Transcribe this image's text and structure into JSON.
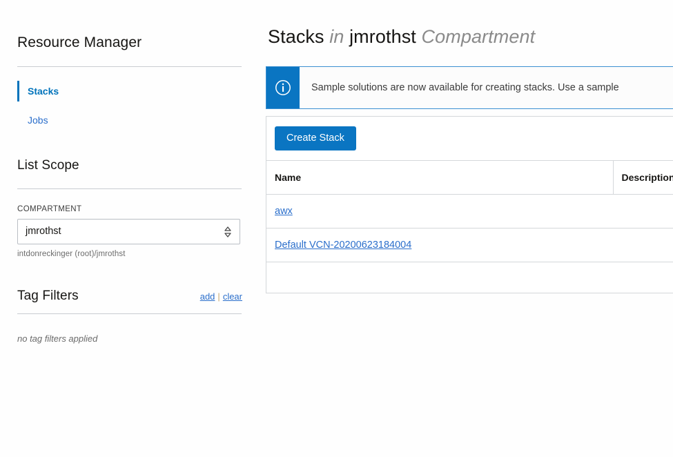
{
  "sidebar": {
    "title": "Resource Manager",
    "nav": [
      {
        "label": "Stacks",
        "active": true
      },
      {
        "label": "Jobs",
        "active": false
      }
    ],
    "list_scope": {
      "title": "List Scope",
      "compartment_label": "COMPARTMENT",
      "compartment_value": "jmrothst",
      "compartment_path": "intdonreckinger (root)/jmrothst",
      "stepper_icon": "chevron-up-down-icon"
    },
    "tag_filters": {
      "title": "Tag Filters",
      "add_label": "add",
      "separator": "|",
      "clear_label": "clear",
      "empty_message": "no tag filters applied"
    }
  },
  "main": {
    "heading": {
      "prefix": "Stacks",
      "in_word": "in",
      "compartment": "jmrothst",
      "suffix": "Compartment"
    },
    "banner": {
      "icon": "info-circle-icon",
      "message": "Sample solutions are now available for creating stacks. Use a sample"
    },
    "toolbar": {
      "create_stack_label": "Create Stack"
    },
    "table": {
      "columns": [
        {
          "key": "name",
          "label": "Name"
        },
        {
          "key": "description",
          "label": "Description"
        }
      ],
      "rows": [
        {
          "name": "awx",
          "description": ""
        },
        {
          "name": "Default VCN-20200623184004",
          "description": ""
        }
      ]
    }
  },
  "colors": {
    "accent_blue": "#0a75c2",
    "link_blue": "#2a6ecb",
    "active_blue": "#0073bb",
    "border_gray": "#d4d7da",
    "text_dark": "#161513",
    "text_muted": "#6b6b6b"
  }
}
